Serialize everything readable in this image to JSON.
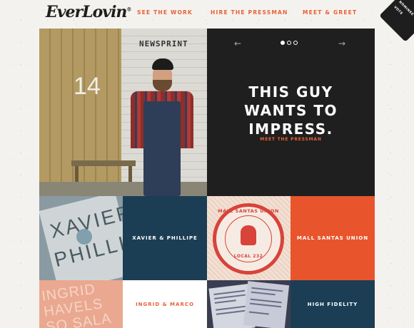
{
  "header": {
    "logo_text": "EverLovin",
    "logo_mark": "®",
    "nav": [
      {
        "label": "SEE THE WORK"
      },
      {
        "label": "HIRE THE PRESSMAN"
      },
      {
        "label": "MEET & GREET"
      }
    ],
    "corner_badge": {
      "line1": "NOMINEE",
      "line2": "VOTE"
    }
  },
  "hero": {
    "headline_lines": [
      "THIS GUY",
      "WANTS TO",
      "IMPRESS."
    ],
    "cta": "MEET THE PRESSMAN",
    "slider": {
      "total": 3,
      "active": 1
    },
    "photo": {
      "door_number": "14",
      "sign_text": "NEWSPRINT"
    }
  },
  "tiles": [
    {
      "label": "XAVIER & PHILLIPE",
      "thumb_text": [
        "XAVIER",
        "PHILLI"
      ],
      "color": "#1c3e55"
    },
    {
      "label": "MALL SANTAS UNION",
      "thumb_text": {
        "top": "MALL SANTAS UNION",
        "bottom": "LOCAL 232"
      },
      "color": "#e8552d"
    },
    {
      "label": "INGRID & MARCO",
      "thumb_text": [
        "INGRID HAVELS",
        "SO SALA"
      ],
      "color": "#ffffff"
    },
    {
      "label": "HIGH FIDELITY",
      "color": "#1c3e55"
    }
  ],
  "colors": {
    "accent": "#e86138",
    "navy": "#1c3e55",
    "dark": "#1f1f1f"
  }
}
